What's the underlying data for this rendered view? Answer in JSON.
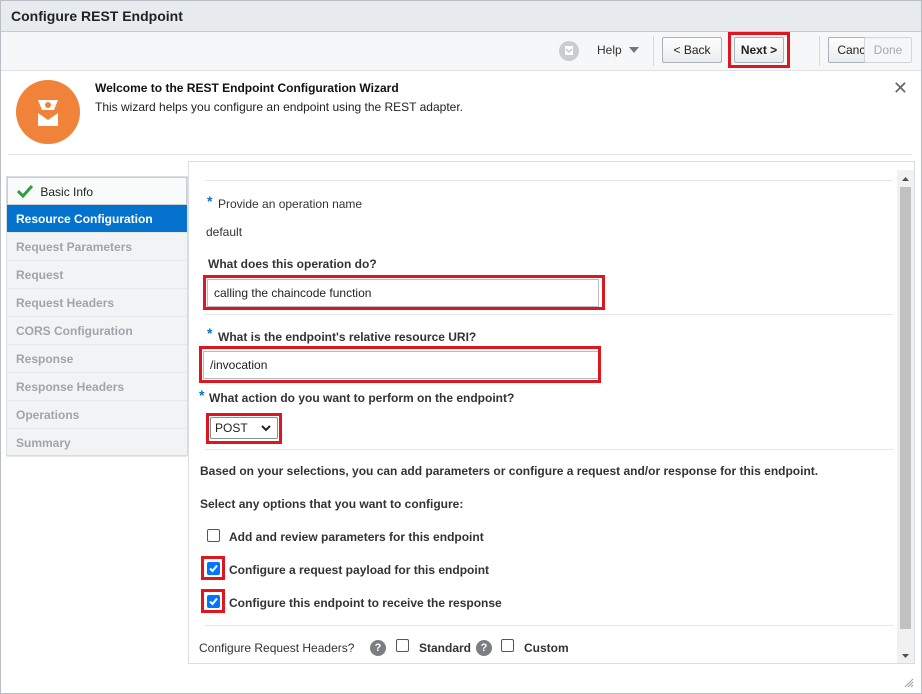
{
  "window": {
    "title": "Configure REST Endpoint"
  },
  "toolbar": {
    "help_label": "Help",
    "back_label": "< Back",
    "next_label": "Next >",
    "cancel_label": "Cancel",
    "done_label": "Done"
  },
  "welcome": {
    "title": "Welcome to the REST Endpoint Configuration Wizard",
    "description": "This wizard helps you configure an endpoint using the REST adapter.",
    "close_glyph": "✕"
  },
  "steps": [
    {
      "label": "Basic Info",
      "state": "done"
    },
    {
      "label": "Resource Configuration",
      "state": "active"
    },
    {
      "label": "Request Parameters",
      "state": "disabled"
    },
    {
      "label": "Request",
      "state": "disabled"
    },
    {
      "label": "Request Headers",
      "state": "disabled"
    },
    {
      "label": "CORS Configuration",
      "state": "disabled"
    },
    {
      "label": "Response",
      "state": "disabled"
    },
    {
      "label": "Response Headers",
      "state": "disabled"
    },
    {
      "label": "Operations",
      "state": "disabled"
    },
    {
      "label": "Summary",
      "state": "disabled"
    }
  ],
  "form": {
    "required_marker": "*",
    "operation_name_label": "Provide an operation name",
    "operation_name_value": "default",
    "operation_do_label": "What does this operation do?",
    "operation_do_value": "calling the chaincode function",
    "uri_label": "What is the endpoint's relative resource URI?",
    "uri_value": "/invocation",
    "action_label": "What action do you want to perform on the endpoint?",
    "action_value": "POST",
    "selections_info": "Based on your selections, you can add parameters or configure a request and/or response for this endpoint.",
    "options_label": "Select any options that you want to configure:",
    "options": [
      {
        "label": "Add and review parameters for this endpoint",
        "checked": false
      },
      {
        "label": "Configure a request payload for this endpoint",
        "checked": true
      },
      {
        "label": "Configure this endpoint to receive the response",
        "checked": true
      }
    ],
    "headers_label": "Configure Request Headers?",
    "help_glyph": "?",
    "standard_label": "Standard",
    "custom_label": "Custom"
  },
  "colors": {
    "accent": "#0572ce",
    "highlight": "#e0161f",
    "logo": "#f0823a",
    "check_green": "#2e9e3f"
  },
  "icons": [
    "help-icon",
    "dropdown-arrow-icon",
    "close-icon",
    "wizard-logo-icon",
    "checkmark-icon",
    "question-icon",
    "scroll-up-icon",
    "scroll-down-icon",
    "resize-grip-icon",
    "chevron-down-icon"
  ]
}
